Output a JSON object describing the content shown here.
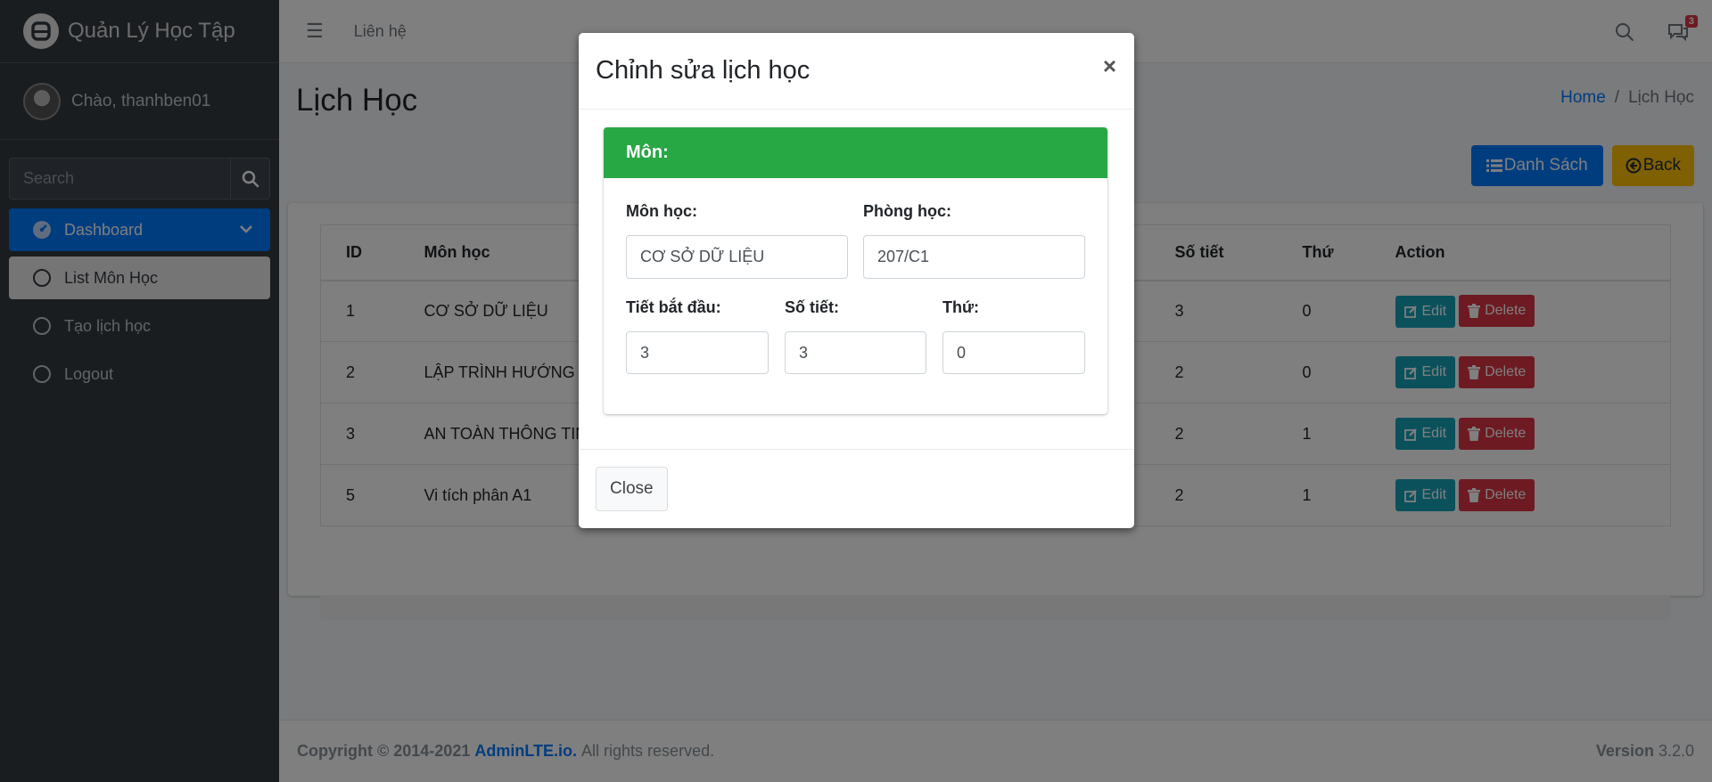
{
  "brand": {
    "title": "Quản Lý Học Tập",
    "logo_icon": "adminlte-logo-icon"
  },
  "user": {
    "greeting": "Chào, thanhben01"
  },
  "sidebar": {
    "search_placeholder": "Search",
    "items": [
      {
        "label": "Dashboard"
      },
      {
        "label": "List Môn Học"
      },
      {
        "label": "Tạo lịch học"
      },
      {
        "label": "Logout"
      }
    ]
  },
  "navbar": {
    "link": "Liên hệ",
    "notification_count": "3"
  },
  "page": {
    "title": "Lịch Học",
    "breadcrumb": {
      "home": "Home",
      "current": "Lịch Học",
      "separator": "/"
    },
    "buttons": {
      "list": "Danh Sách",
      "back": "Back"
    }
  },
  "table": {
    "headers": {
      "id": "ID",
      "subject": "Môn học",
      "periods": "Số tiết",
      "day": "Thứ",
      "action": "Action"
    },
    "rows": [
      {
        "id": "1",
        "subject": "CƠ SỞ DỮ LIỆU",
        "periods": "3",
        "day": "0"
      },
      {
        "id": "2",
        "subject": "LẬP TRÌNH HƯỚNG ĐỐ",
        "periods": "2",
        "day": "0"
      },
      {
        "id": "3",
        "subject": "AN TOÀN THÔNG TIN",
        "periods": "2",
        "day": "1"
      },
      {
        "id": "5",
        "subject": "Vi tích phân A1",
        "periods": "2",
        "day": "1"
      }
    ],
    "edit_label": "Edit",
    "delete_label": "Delete"
  },
  "footer": {
    "copyright": "Copyright © 2014-2021",
    "brand_link": "AdminLTE.io.",
    "rights": "All rights reserved.",
    "version_label": "Version",
    "version": "3.2.0"
  },
  "modal": {
    "title": "Chỉnh sửa lịch học",
    "close_symbol": "×",
    "card_header": "Môn:",
    "fields": {
      "subject": {
        "label": "Môn học:",
        "value": "CƠ SỞ DỮ LIỆU"
      },
      "room": {
        "label": "Phòng học:",
        "value": "207/C1"
      },
      "start_period": {
        "label": "Tiết bắt đầu:",
        "value": "3"
      },
      "periods": {
        "label": "Số tiết:",
        "value": "3"
      },
      "day": {
        "label": "Thứ:",
        "value": "0"
      }
    },
    "close_button": "Close"
  },
  "colors": {
    "sidebar_bg": "#343a40",
    "primary": "#007bff",
    "warning": "#ffc107",
    "success": "#28a745",
    "info": "#17a2b8",
    "danger": "#dc3545"
  }
}
